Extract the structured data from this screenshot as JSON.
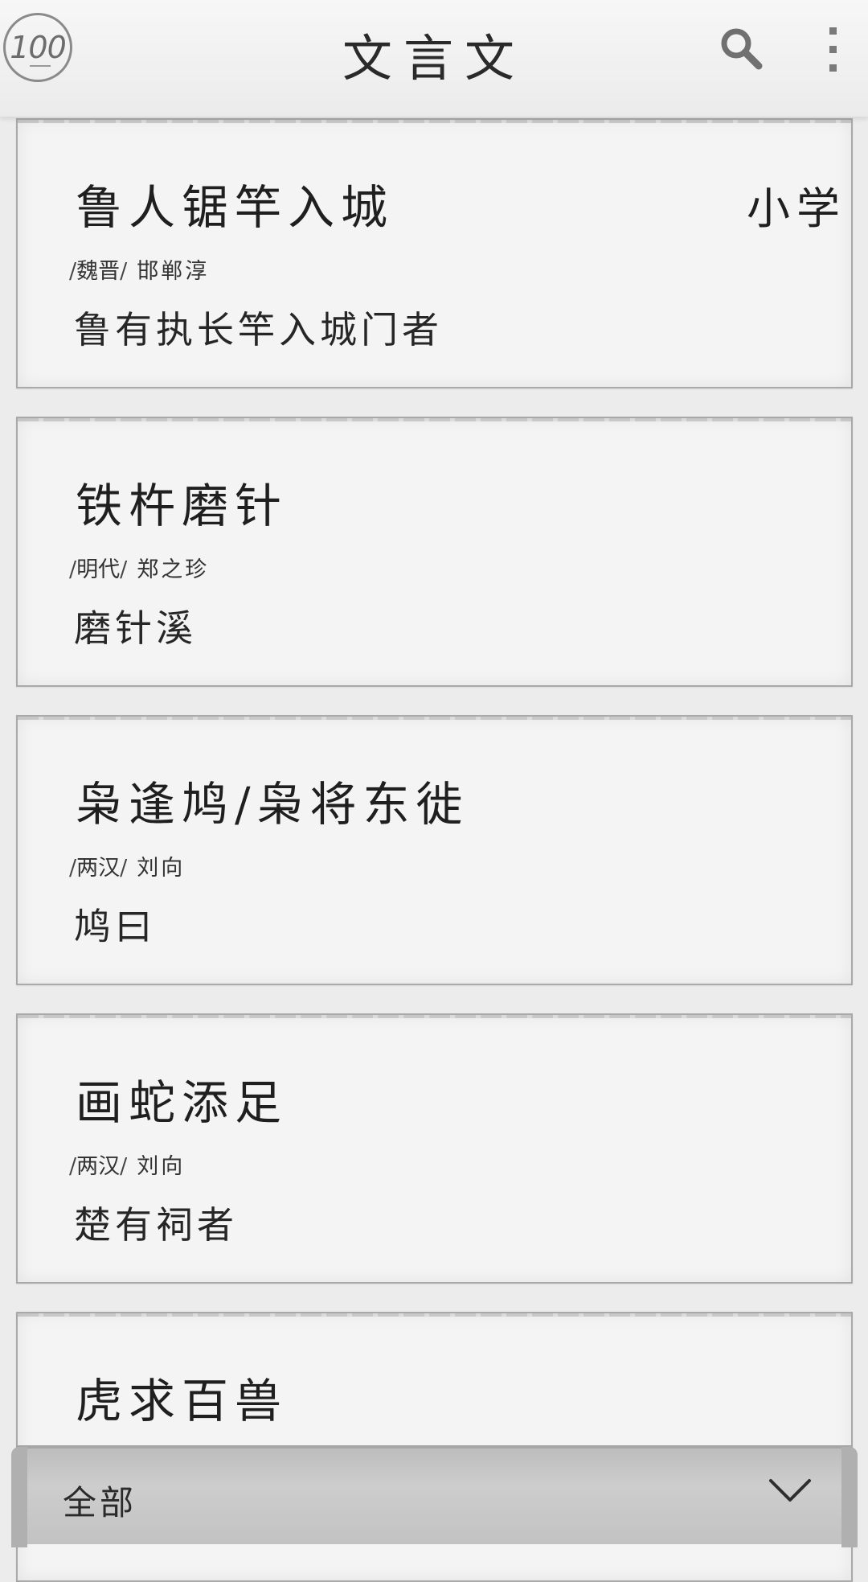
{
  "header": {
    "badge_text": "100",
    "title": "文言文",
    "icons": [
      "search-icon",
      "more-vertical-icon"
    ]
  },
  "cards": [
    {
      "title": "鲁人锯竿入城",
      "dynasty": "魏晋",
      "author": "邯郸淳",
      "excerpt": "鲁有执长竿入城门者",
      "grade": "小学"
    },
    {
      "title": "铁杵磨针",
      "dynasty": "明代",
      "author": "郑之珍",
      "excerpt": "磨针溪"
    },
    {
      "title": "枭逢鸠/枭将东徙",
      "dynasty": "两汉",
      "author": "刘向",
      "excerpt": "鸠曰"
    },
    {
      "title": "画蛇添足",
      "dynasty": "两汉",
      "author": "刘向",
      "excerpt": "楚有祠者"
    },
    {
      "title": "虎求百兽"
    }
  ],
  "filter": {
    "label": "全部",
    "icon": "chevron-down-icon"
  },
  "colors": {
    "background": "#ececec",
    "card": "#f4f4f4",
    "text": "#2a2a2a",
    "filter_bar": "#c4c4c4"
  }
}
